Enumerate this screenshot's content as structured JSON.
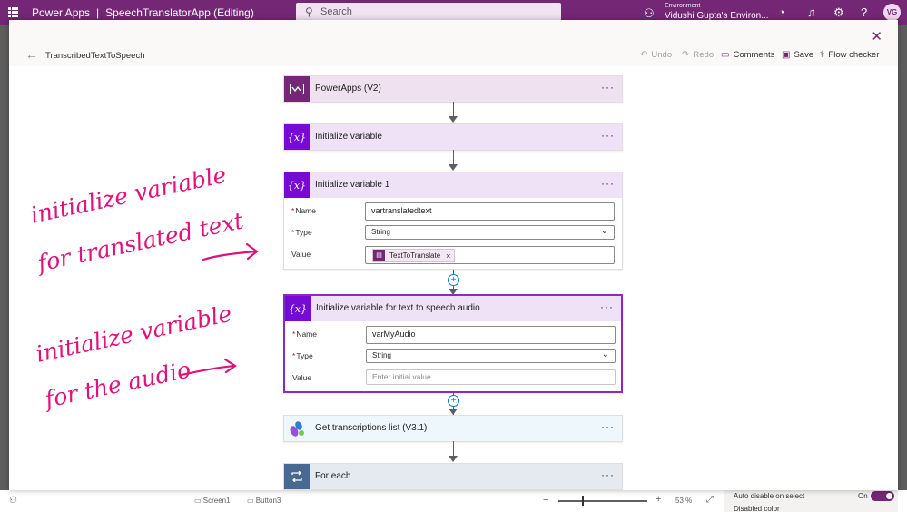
{
  "topbar": {
    "app_name": "Power Apps",
    "separator": "|",
    "doc_title": "SpeechTranslatorApp (Editing)",
    "search_placeholder": "Search",
    "environment_label": "Environment",
    "environment_name": "Vidushi Gupta's Environ...",
    "avatar_initials": "VG"
  },
  "flow": {
    "name": "TranscribedTextToSpeech",
    "commands": {
      "undo": "Undo",
      "redo": "Redo",
      "comments": "Comments",
      "save": "Save",
      "flow_checker": "Flow checker"
    },
    "steps": [
      {
        "title": "PowerApps (V2)",
        "icon": "power-apps-icon"
      },
      {
        "title": "Initialize variable",
        "icon": "variable-icon"
      },
      {
        "title": "Initialize variable 1",
        "icon": "variable-icon",
        "fields": {
          "name_label": "Name",
          "name_value": "vartranslatedtext",
          "type_label": "Type",
          "type_value": "String",
          "value_label": "Value",
          "value_token": "TextToTranslate"
        }
      },
      {
        "title": "Initialize variable for text to speech audio",
        "icon": "variable-icon",
        "fields": {
          "name_label": "Name",
          "name_value": "varMyAudio",
          "type_label": "Type",
          "type_value": "String",
          "value_label": "Value",
          "value_placeholder": "Enter initial value"
        }
      },
      {
        "title": "Get transcriptions list (V3.1)",
        "icon": "cognitive-services-icon"
      },
      {
        "title": "For each",
        "icon": "loop-icon"
      }
    ],
    "more_label": "···",
    "required_mark": "*",
    "token_remove": "×"
  },
  "annotations": {
    "note1_line1": "initialize variable",
    "note1_line2": "for translated text",
    "note2_line1": "initialize variable",
    "note2_line2": "for the audio"
  },
  "studio": {
    "screen_label": "Screen1",
    "button_label": "Button3",
    "zoom": "53  %",
    "prop_auto_disable": "Auto disable on select",
    "prop_on": "On",
    "prop_disabled_color": "Disabled color"
  },
  "colors": {
    "powerapps_purple": "#742774",
    "variable_purple": "#770bd6",
    "annotation_pink": "#e0127a",
    "loop_blue": "#486991"
  }
}
